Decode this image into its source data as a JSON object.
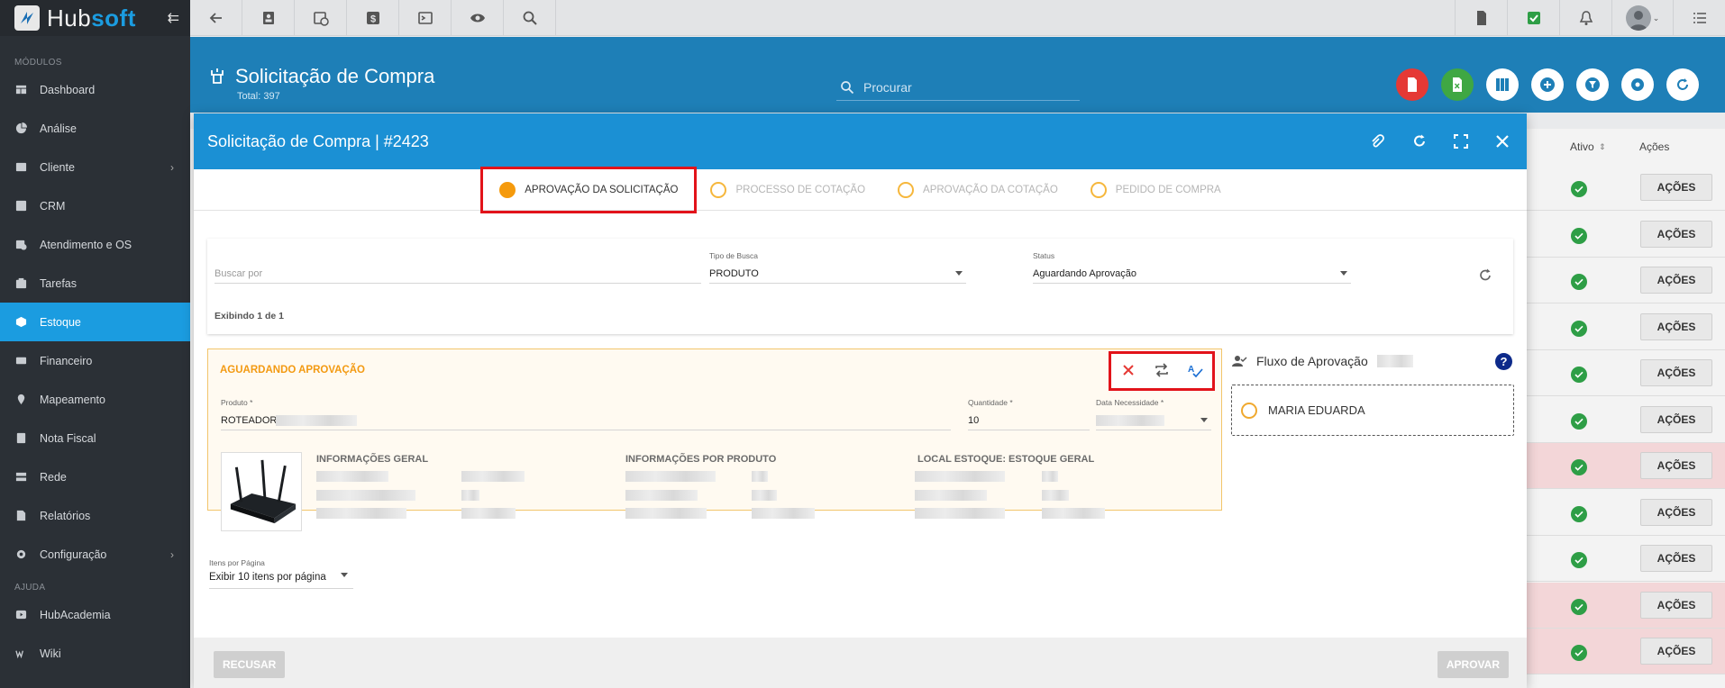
{
  "brand": {
    "name_part1": "Hub",
    "name_part2": "soft"
  },
  "sidebar": {
    "section_modules": "MÓDULOS",
    "section_help": "AJUDA",
    "items": [
      {
        "label": "Dashboard",
        "icon": "dashboard-icon"
      },
      {
        "label": "Análise",
        "icon": "pie-chart-icon"
      },
      {
        "label": "Cliente",
        "icon": "id-card-icon"
      },
      {
        "label": "CRM",
        "icon": "crm-icon"
      },
      {
        "label": "Atendimento e OS",
        "icon": "calendar-clock-icon"
      },
      {
        "label": "Tarefas",
        "icon": "tasks-icon"
      },
      {
        "label": "Estoque",
        "icon": "box-icon"
      },
      {
        "label": "Financeiro",
        "icon": "money-icon"
      },
      {
        "label": "Mapeamento",
        "icon": "map-pin-icon"
      },
      {
        "label": "Nota Fiscal",
        "icon": "invoice-icon"
      },
      {
        "label": "Rede",
        "icon": "network-icon"
      },
      {
        "label": "Relatórios",
        "icon": "report-icon"
      },
      {
        "label": "Configuração",
        "icon": "gear-icon"
      }
    ],
    "help_items": [
      {
        "label": "HubAcademia",
        "icon": "play-icon"
      },
      {
        "label": "Wiki",
        "icon": "wiki-icon"
      }
    ]
  },
  "page": {
    "title": "Solicitação de Compra",
    "subtitle": "Total: 397",
    "search_placeholder": "Procurar"
  },
  "table": {
    "col_active": "Ativo",
    "col_actions": "Ações",
    "row_button": "AÇÕES"
  },
  "modal": {
    "title": "Solicitação de Compra | #2423",
    "steps": [
      "APROVAÇÃO DA SOLICITAÇÃO",
      "PROCESSO DE COTAÇÃO",
      "APROVAÇÃO DA COTAÇÃO",
      "PEDIDO DE COMPRA"
    ],
    "filter": {
      "search_placeholder": "Buscar por",
      "type_label": "Tipo de Busca",
      "type_value": "PRODUTO",
      "status_label": "Status",
      "status_value": "Aguardando Aprovação",
      "showing": "Exibindo 1 de 1"
    },
    "request": {
      "status_title": "AGUARDANDO APROVAÇÃO",
      "product_label": "Produto *",
      "product_value": "ROTEADOR",
      "qty_label": "Quantidade *",
      "qty_value": "10",
      "date_label": "Data Necessidade *",
      "info_general": "INFORMAÇÕES GERAL",
      "info_product": "INFORMAÇÕES POR PRODUTO",
      "info_stock": "LOCAL ESTOQUE: ESTOQUE GERAL"
    },
    "flow": {
      "title": "Fluxo de Aprovação",
      "approver": "MARIA EDUARDA",
      "help": "?"
    },
    "per_page": {
      "label": "Itens por Página",
      "value": "Exibir 10 itens por página"
    },
    "footer": {
      "reject": "RECUSAR",
      "approve": "APROVAR"
    }
  },
  "colors": {
    "primary": "#1b90d4",
    "sidebar": "#2b3036",
    "active": "#1b9ce0",
    "warning": "#f39a12",
    "danger": "#e2131a"
  }
}
